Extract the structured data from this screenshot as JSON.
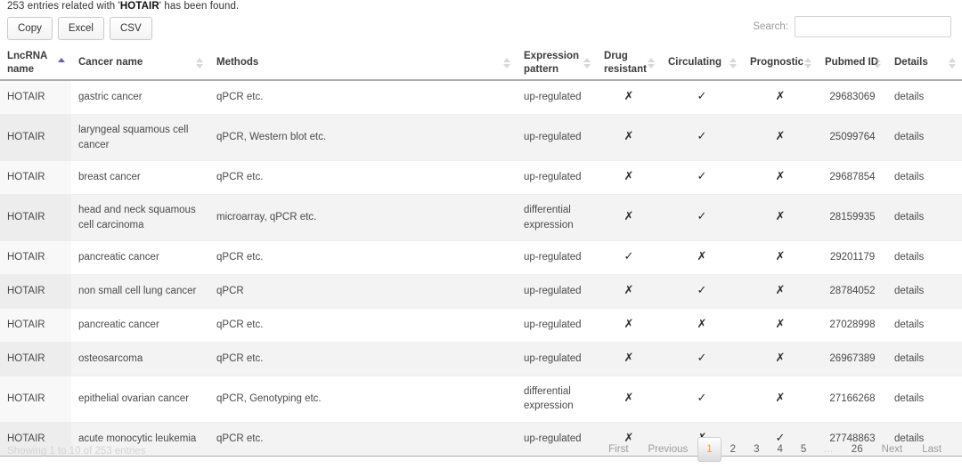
{
  "notice": {
    "prefix": "253 entries related with '",
    "term": "HOTAIR",
    "suffix": "' has been found."
  },
  "toolbar": {
    "buttons": [
      {
        "label": "Copy",
        "name": "copy-button"
      },
      {
        "label": "Excel",
        "name": "excel-button"
      },
      {
        "label": "CSV",
        "name": "csv-button"
      }
    ]
  },
  "search": {
    "label": "Search:",
    "value": "",
    "placeholder": ""
  },
  "table": {
    "columns": [
      {
        "label": "LncRNA name",
        "sort": "asc",
        "align": "left"
      },
      {
        "label": "Cancer name",
        "sort": "none",
        "align": "left"
      },
      {
        "label": "Methods",
        "sort": "none",
        "align": "left"
      },
      {
        "label": "Expression pattern",
        "sort": "none",
        "align": "left"
      },
      {
        "label": "Drug resistant",
        "sort": "none",
        "align": "left"
      },
      {
        "label": "Circulating",
        "sort": "none",
        "align": "left"
      },
      {
        "label": "Prognostic",
        "sort": "none",
        "align": "left"
      },
      {
        "label": "Pubmed ID",
        "sort": "none",
        "align": "left"
      },
      {
        "label": "Details",
        "sort": "none",
        "align": "left"
      }
    ],
    "rows": [
      {
        "lncrna": "HOTAIR",
        "cancer": "gastric cancer",
        "methods": "qPCR etc.",
        "expression": "up-regulated",
        "drug_resistant": "✗",
        "circulating": "✓",
        "prognostic": "✗",
        "pubmed": "29683069",
        "details": "details"
      },
      {
        "lncrna": "HOTAIR",
        "cancer": "laryngeal squamous cell cancer",
        "methods": "qPCR, Western blot etc.",
        "expression": "up-regulated",
        "drug_resistant": "✗",
        "circulating": "✓",
        "prognostic": "✗",
        "pubmed": "25099764",
        "details": "details"
      },
      {
        "lncrna": "HOTAIR",
        "cancer": "breast cancer",
        "methods": "qPCR etc.",
        "expression": "up-regulated",
        "drug_resistant": "✗",
        "circulating": "✓",
        "prognostic": "✗",
        "pubmed": "29687854",
        "details": "details"
      },
      {
        "lncrna": "HOTAIR",
        "cancer": "head and neck squamous cell carcinoma",
        "methods": "microarray, qPCR etc.",
        "expression": "differential expression",
        "drug_resistant": "✗",
        "circulating": "✓",
        "prognostic": "✗",
        "pubmed": "28159935",
        "details": "details"
      },
      {
        "lncrna": "HOTAIR",
        "cancer": "pancreatic cancer",
        "methods": "qPCR etc.",
        "expression": "up-regulated",
        "drug_resistant": "✓",
        "circulating": "✗",
        "prognostic": "✗",
        "pubmed": "29201179",
        "details": "details"
      },
      {
        "lncrna": "HOTAIR",
        "cancer": "non small cell lung cancer",
        "methods": "qPCR",
        "expression": "up-regulated",
        "drug_resistant": "✗",
        "circulating": "✓",
        "prognostic": "✗",
        "pubmed": "28784052",
        "details": "details"
      },
      {
        "lncrna": "HOTAIR",
        "cancer": "pancreatic cancer",
        "methods": "qPCR etc.",
        "expression": "up-regulated",
        "drug_resistant": "✗",
        "circulating": "✗",
        "prognostic": "✗",
        "pubmed": "27028998",
        "details": "details"
      },
      {
        "lncrna": "HOTAIR",
        "cancer": "osteosarcoma",
        "methods": "qPCR etc.",
        "expression": "up-regulated",
        "drug_resistant": "✗",
        "circulating": "✓",
        "prognostic": "✗",
        "pubmed": "26967389",
        "details": "details"
      },
      {
        "lncrna": "HOTAIR",
        "cancer": "epithelial ovarian cancer",
        "methods": "qPCR, Genotyping etc.",
        "expression": "differential expression",
        "drug_resistant": "✗",
        "circulating": "✓",
        "prognostic": "✗",
        "pubmed": "27166268",
        "details": "details"
      },
      {
        "lncrna": "HOTAIR",
        "cancer": "acute monocytic leukemia",
        "methods": "qPCR etc.",
        "expression": "up-regulated",
        "drug_resistant": "✗",
        "circulating": "✗",
        "prognostic": "✓",
        "pubmed": "27748863",
        "details": "details"
      }
    ]
  },
  "footer": {
    "info": "Showing 1 to 10 of 253 entries",
    "pagination": [
      {
        "label": "First",
        "type": "edge",
        "active": false
      },
      {
        "label": "Previous",
        "type": "edge",
        "active": false
      },
      {
        "label": "1",
        "type": "num",
        "active": true
      },
      {
        "label": "2",
        "type": "num",
        "active": false
      },
      {
        "label": "3",
        "type": "num",
        "active": false
      },
      {
        "label": "4",
        "type": "num",
        "active": false
      },
      {
        "label": "5",
        "type": "num",
        "active": false
      },
      {
        "label": "…",
        "type": "ellipsis",
        "active": false
      },
      {
        "label": "26",
        "type": "num",
        "active": false
      },
      {
        "label": "Next",
        "type": "edge",
        "active": false
      },
      {
        "label": "Last",
        "type": "edge",
        "active": false
      }
    ]
  },
  "colors": {
    "sort_active": "#6a5acd",
    "page_active_text": "#e8a33d",
    "header_border": "#adadad",
    "row_alt": "#f3f3f3"
  }
}
